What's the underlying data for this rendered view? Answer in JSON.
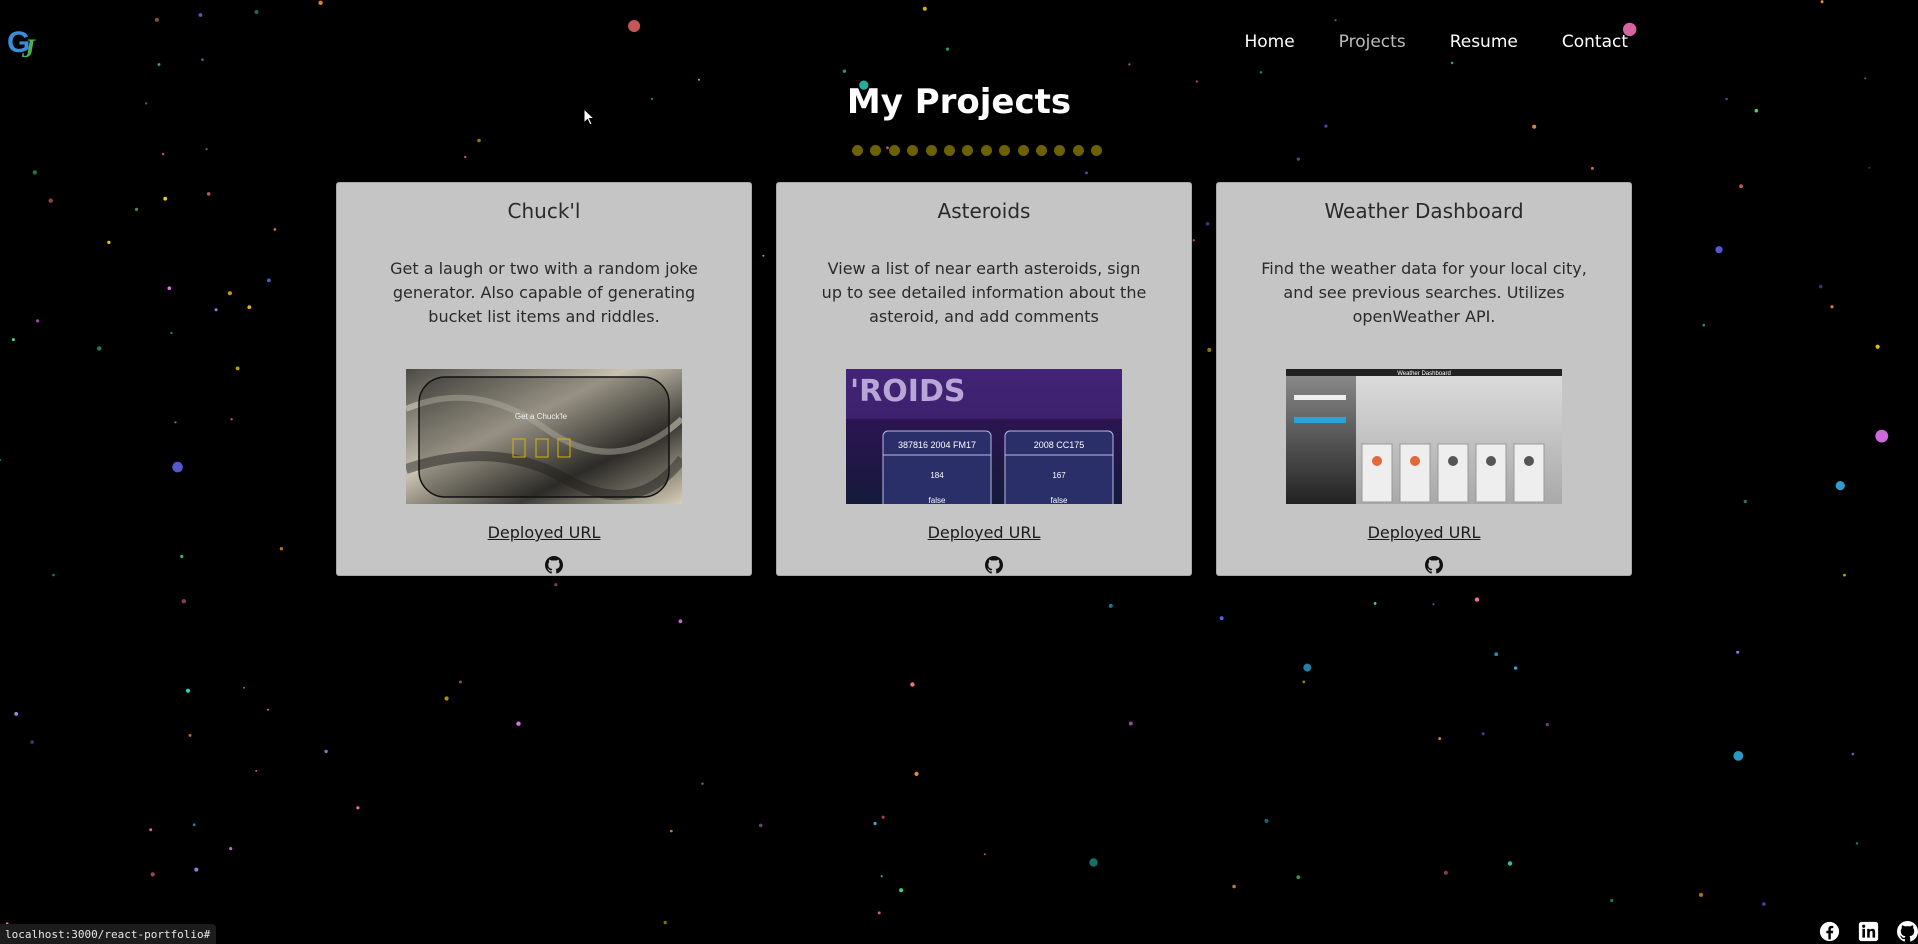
{
  "logo": {
    "text": "GJ",
    "colors": [
      "#3b8ed6",
      "#4caf50"
    ]
  },
  "nav": {
    "items": [
      {
        "label": "Home"
      },
      {
        "label": "Projects",
        "active": true
      },
      {
        "label": "Resume"
      },
      {
        "label": "Contact"
      }
    ]
  },
  "main": {
    "title": "My Projects",
    "divider_color": "#6b6100",
    "projects": [
      {
        "title": "Chuck'l",
        "description": "Get a laugh or two with a random joke generator. Also capable of generating bucket list items and riddles.",
        "screenshot": {
          "heading": "Get a Chuck'le"
        },
        "link_label": "Deployed URL",
        "github_icon": "github-icon"
      },
      {
        "title": "Asteroids",
        "description": "View a list of near earth asteroids, sign up to see detailed information about the asteroid, and add comments",
        "screenshot": {
          "brand": "'ROIDS",
          "items": [
            {
              "name": "387816 2004 FM17",
              "value": "184",
              "flag": "false"
            },
            {
              "name": "2008 CC175",
              "value": "167",
              "flag": "false"
            }
          ]
        },
        "link_label": "Deployed URL",
        "github_icon": "github-icon"
      },
      {
        "title": "Weather Dashboard",
        "description": "Find the weather data for your local city, and see previous searches. Utilizes openWeather API.",
        "screenshot": {
          "heading": "Weather Dashboard"
        },
        "link_label": "Deployed URL",
        "github_icon": "github-icon"
      }
    ]
  },
  "status_bar": {
    "url": "localhost:3000/react-portfolio#"
  },
  "footer": {
    "icons": [
      "facebook-icon",
      "linkedin-icon",
      "github-icon"
    ]
  }
}
